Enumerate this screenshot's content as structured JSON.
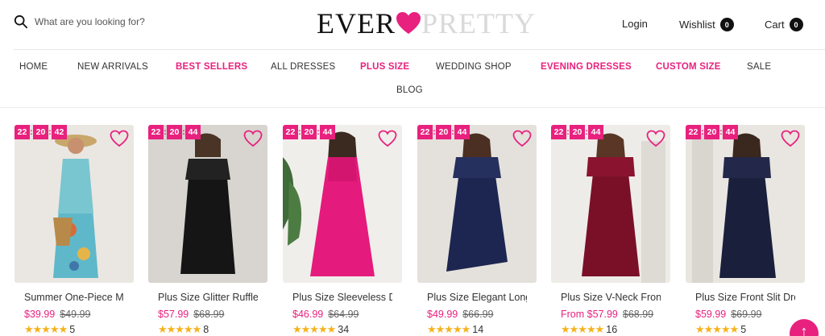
{
  "header": {
    "search_placeholder": "What are you looking for?",
    "logo_left": "EVER",
    "logo_right": "PRETTY",
    "login_label": "Login",
    "wishlist_label": "Wishlist",
    "wishlist_count": "0",
    "cart_label": "Cart",
    "cart_count": "0"
  },
  "nav": {
    "items": [
      {
        "label": "HOME"
      },
      {
        "label": "NEW ARRIVALS"
      },
      {
        "label": "BEST SELLERS"
      },
      {
        "label": "ALL DRESSES"
      },
      {
        "label": "PLUS SIZE"
      },
      {
        "label": "WEDDING SHOP"
      },
      {
        "label": "EVENING DRESSES"
      },
      {
        "label": "CUSTOM SIZE"
      },
      {
        "label": "SALE"
      },
      {
        "label": "BLOG"
      }
    ]
  },
  "products": [
    {
      "timer": [
        "22",
        "20",
        "42"
      ],
      "title": "Summer One-Piece Maxi Dress",
      "price": "$39.99",
      "old_price": "$49.99",
      "stars": "★★★★★",
      "reviews": "5"
    },
    {
      "timer": [
        "22",
        "20",
        "44"
      ],
      "title": "Plus Size Glitter Ruffle Dress",
      "price": "$57.99",
      "old_price": "$68.99",
      "stars": "★★★★★",
      "reviews": "8"
    },
    {
      "timer": [
        "22",
        "20",
        "44"
      ],
      "title": "Plus Size Sleeveless Dress",
      "price": "$46.99",
      "old_price": "$64.99",
      "stars": "★★★★★",
      "reviews": "34"
    },
    {
      "timer": [
        "22",
        "20",
        "44"
      ],
      "title": "Plus Size Elegant Long Dress",
      "price": "$49.99",
      "old_price": "$66.99",
      "stars": "★★★★★",
      "reviews": "14"
    },
    {
      "timer": [
        "22",
        "20",
        "44"
      ],
      "title": "Plus Size V-Neck Front Slit",
      "price": "From $57.99",
      "old_price": "$68.99",
      "stars": "★★★★★",
      "reviews": "16"
    },
    {
      "timer": [
        "22",
        "20",
        "44"
      ],
      "title": "Plus Size Front Slit Dress",
      "price": "$59.99",
      "old_price": "$69.99",
      "stars": "★★★★★",
      "reviews": "5"
    }
  ],
  "colors": {
    "accent": "#e8217e",
    "star": "#f5b21b"
  },
  "icons": {
    "search": "search-icon",
    "wishlist_heart": "heart-outline-icon",
    "back_to_top": "arrow-up-icon"
  }
}
